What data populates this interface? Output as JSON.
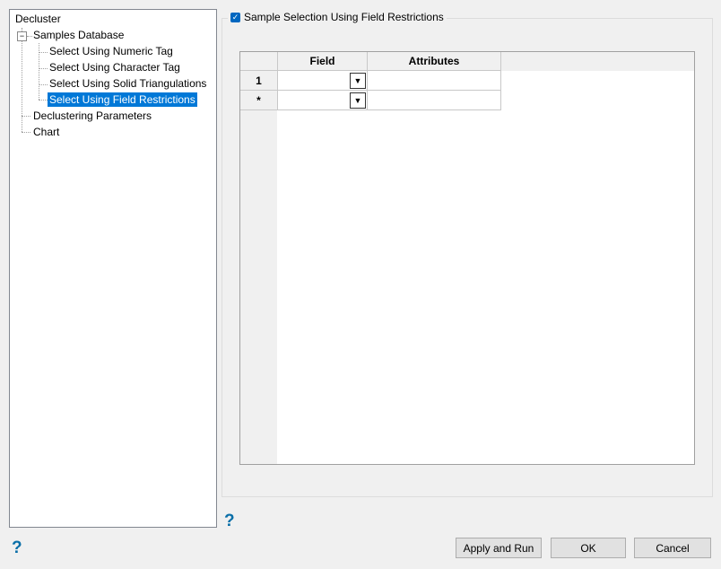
{
  "tree": {
    "root": "Decluster",
    "items": [
      {
        "label": "Samples Database"
      },
      {
        "label": "Select Using Numeric Tag"
      },
      {
        "label": "Select Using Character Tag"
      },
      {
        "label": "Select Using Solid Triangulations"
      },
      {
        "label": "Select Using Field Restrictions",
        "selected": true
      },
      {
        "label": "Declustering Parameters"
      },
      {
        "label": "Chart"
      }
    ]
  },
  "group": {
    "checkbox_label": "Sample Selection Using Field Restrictions",
    "checked": true
  },
  "grid": {
    "columns": [
      "Field",
      "Attributes"
    ],
    "rows": [
      {
        "header": "1",
        "field": "",
        "attributes": ""
      },
      {
        "header": "*",
        "field": "",
        "attributes": ""
      }
    ]
  },
  "buttons": {
    "apply_run": "Apply and Run",
    "ok": "OK",
    "cancel": "Cancel"
  },
  "help": "?"
}
